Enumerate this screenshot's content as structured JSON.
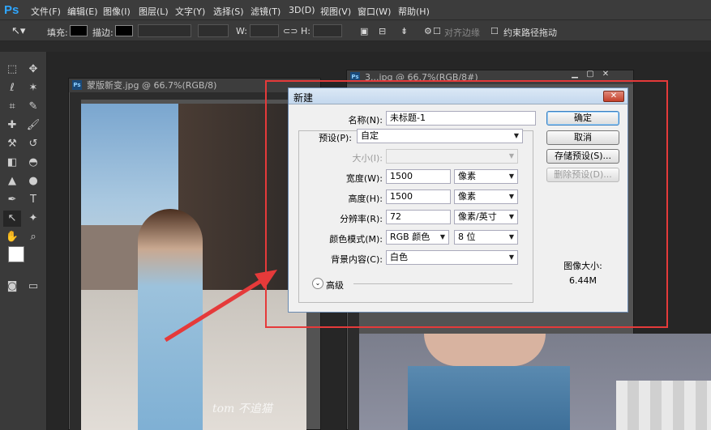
{
  "app": {
    "logo": "Ps",
    "menu": [
      "文件(F)",
      "编辑(E)",
      "图像(I)",
      "图层(L)",
      "文字(Y)",
      "选择(S)",
      "滤镜(T)",
      "3D(D)",
      "视图(V)",
      "窗口(W)",
      "帮助(H)"
    ]
  },
  "options": {
    "fill_label": "填充:",
    "stroke_label": "描边:",
    "w_label": "W:",
    "h_label": "H:",
    "align_edges": "对齐边缘",
    "constrain_path": "约束路径拖动"
  },
  "documents": [
    {
      "title": "蒙版新变.jpg @ 66.7%(RGB/8)"
    },
    {
      "title": "3...jpg @ 66.7%(RGB/8#)"
    }
  ],
  "watermark": "tom 不追猫",
  "dialog": {
    "title": "新建",
    "name_label": "名称(N):",
    "name_value": "未标题-1",
    "preset_label": "预设(P):",
    "preset_value": "自定",
    "size_label": "大小(I):",
    "size_value": "",
    "width_label": "宽度(W):",
    "width_value": "1500",
    "width_unit": "像素",
    "height_label": "高度(H):",
    "height_value": "1500",
    "height_unit": "像素",
    "resolution_label": "分辨率(R):",
    "resolution_value": "72",
    "resolution_unit": "像素/英寸",
    "color_mode_label": "颜色模式(M):",
    "color_mode_value": "RGB 颜色",
    "bit_depth_value": "8 位",
    "background_label": "背景内容(C):",
    "background_value": "白色",
    "advanced_label": "高级",
    "ok_button": "确定",
    "cancel_button": "取消",
    "save_preset_button": "存储预设(S)...",
    "delete_preset_button": "删除预设(D)...",
    "image_size_label": "图像大小:",
    "image_size_value": "6.44M"
  },
  "colors": {
    "highlight_box": "#e53a3a",
    "ps_blue": "#2fa6ff"
  }
}
